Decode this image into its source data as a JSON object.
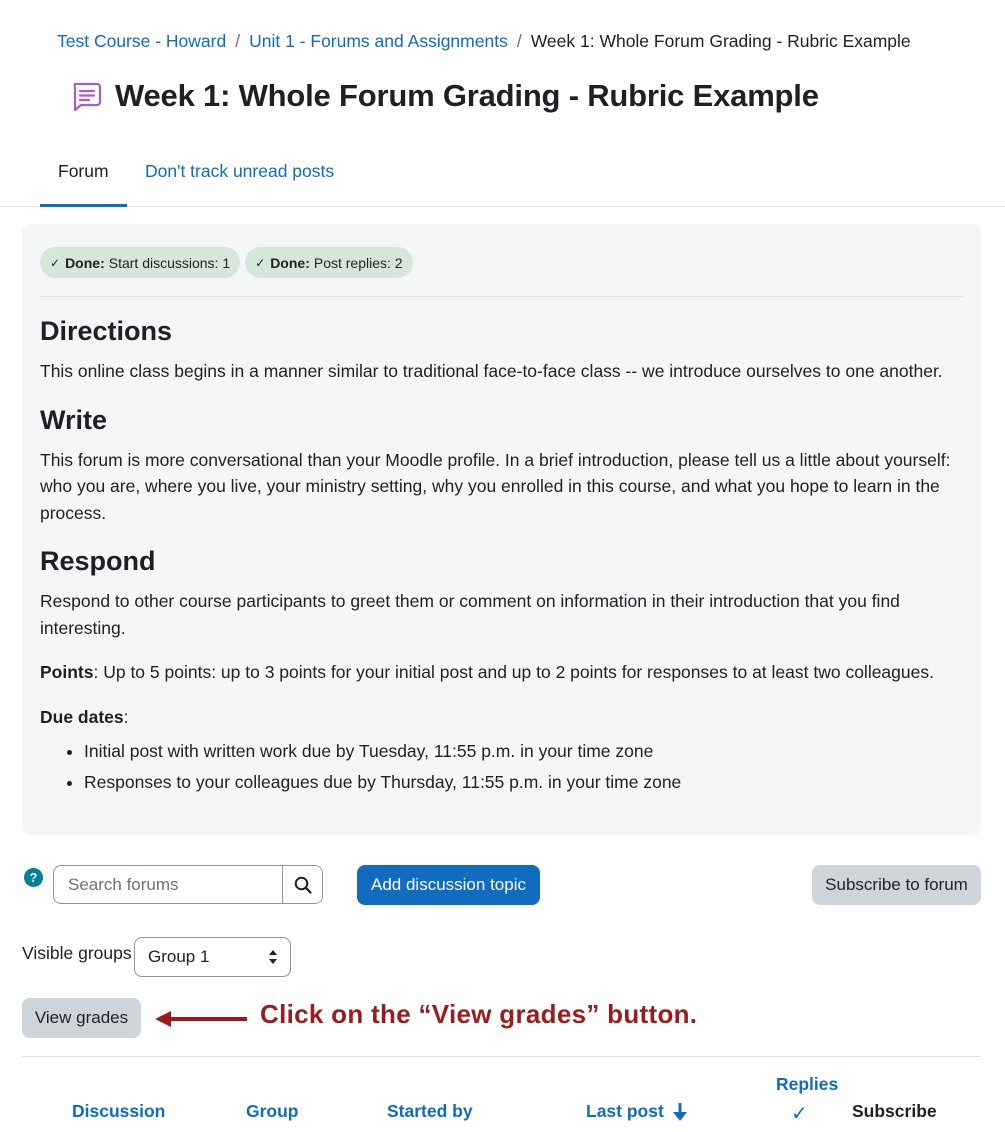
{
  "breadcrumb": {
    "items": [
      "Test Course - Howard",
      "Unit 1 - Forums and Assignments"
    ],
    "current": "Week 1: Whole Forum Grading - Rubric Example",
    "separator": "/"
  },
  "page": {
    "title": "Week 1: Whole Forum Grading - Rubric Example",
    "icon": "forum-icon"
  },
  "tabs": [
    {
      "label": "Forum",
      "active": true
    },
    {
      "label": "Don't track unread posts",
      "active": false
    }
  ],
  "completion": [
    {
      "status": "Done:",
      "label": "Start discussions: 1"
    },
    {
      "status": "Done:",
      "label": "Post replies: 2"
    }
  ],
  "intro": {
    "directions_heading": "Directions",
    "directions_text": "This online class begins in a manner similar to traditional face-to-face class -- we introduce ourselves to one another.",
    "write_heading": "Write",
    "write_text": "This forum is more conversational than your Moodle profile. In a brief introduction, please tell us a little about yourself: who you are, where you live, your ministry setting, why you enrolled in this course, and what you hope to learn in the process.",
    "respond_heading": "Respond",
    "respond_text": "Respond to other course participants to greet them or comment on information in their introduction that you find interesting.",
    "points_label": "Points",
    "points_text": ": Up to 5 points: up to 3 points for your initial post and up to 2 points for responses to at least two colleagues.",
    "due_label": "Due dates",
    "due_suffix": ":",
    "due_items": [
      "Initial post with written work due by Tuesday, 11:55 p.m. in your time zone",
      "Responses to your colleagues due by Thursday, 11:55 p.m. in your time zone"
    ]
  },
  "actions": {
    "help_symbol": "?",
    "search_placeholder": "Search forums",
    "add_discussion": "Add discussion topic",
    "subscribe": "Subscribe to forum"
  },
  "groups": {
    "label": "Visible groups",
    "selected": "Group 1"
  },
  "view_grades": "View grades",
  "annotation": "Click on the “View grades” button.",
  "table_headers": {
    "discussion": "Discussion",
    "group": "Group",
    "started_by": "Started by",
    "last_post": "Last post",
    "replies": "Replies",
    "subscribe": "Subscribe"
  },
  "colors": {
    "link": "#0f6cbf",
    "primary": "#0f6cbf",
    "badge_bg": "#d7e6da",
    "intro_bg": "#f5f6f8",
    "annotation": "#9b1c1c",
    "forum_icon": "#a75bd8"
  }
}
